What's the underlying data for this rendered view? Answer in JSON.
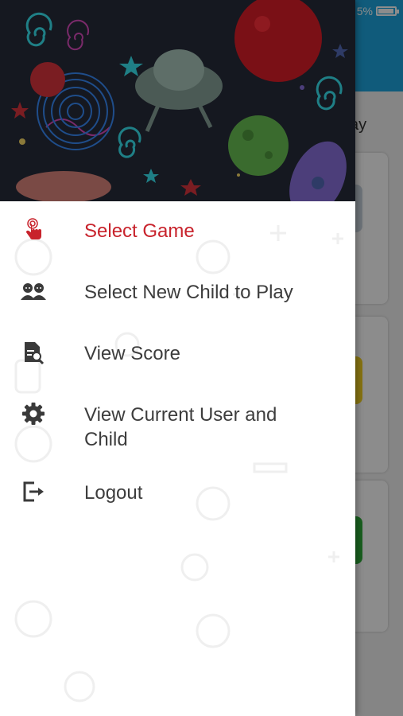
{
  "status_bar": {
    "battery_text": "5%",
    "battery_level": 0.85
  },
  "background_screen": {
    "title_fragment": "ay"
  },
  "drawer": {
    "menu_items": [
      {
        "label": "Select Game",
        "icon": "tap-hand-icon",
        "active": true
      },
      {
        "label": "Select New Child to Play",
        "icon": "children-icon",
        "active": false
      },
      {
        "label": "View Score",
        "icon": "score-document-icon",
        "active": false
      },
      {
        "label": "View Current User and Child",
        "icon": "gear-icon",
        "active": false
      },
      {
        "label": "Logout",
        "icon": "logout-icon",
        "active": false
      }
    ]
  },
  "colors": {
    "accent": "#c8232c",
    "app_bar": "#1ea7e0",
    "header_bg": "#151820",
    "menu_text": "#3d3d3d",
    "icon": "#3a3a3a"
  }
}
